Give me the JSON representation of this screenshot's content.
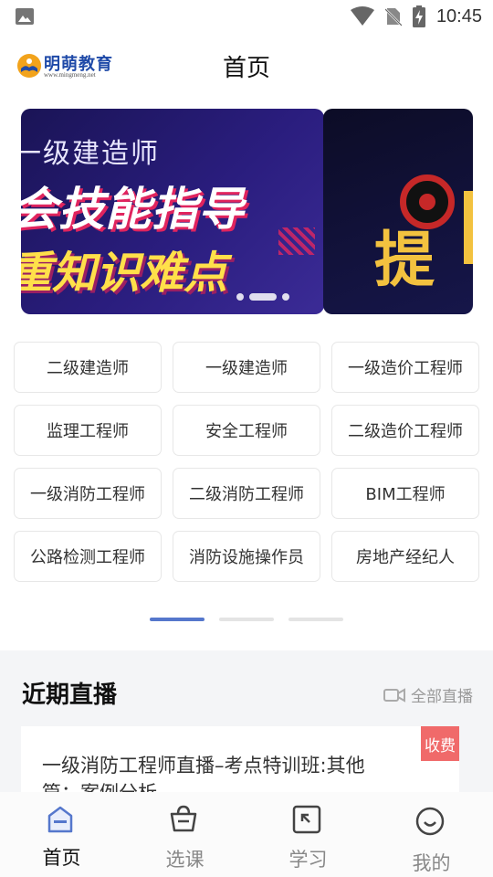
{
  "status_bar": {
    "time": "10:45"
  },
  "header": {
    "logo_text": "明萌教育",
    "logo_url": "www.mingmeng.net",
    "title": "首页"
  },
  "banner": {
    "line1": "一级建造师",
    "line2": "会技能指导",
    "line3": "重知识难点",
    "next_char": "提",
    "next_edge_char": "?",
    "dot_count": 3,
    "active_dot": 1
  },
  "categories": [
    "二级建造师",
    "一级建造师",
    "一级造价工程师",
    "监理工程师",
    "安全工程师",
    "二级造价工程师",
    "一级消防工程师",
    "二级消防工程师",
    "BIM工程师",
    "公路检测工程师",
    "消防设施操作员",
    "房地产经纪人"
  ],
  "category_pager": {
    "pages": 3,
    "active": 0
  },
  "live": {
    "section_title": "近期直播",
    "all_label": "全部直播",
    "card": {
      "title": "一级消防工程师直播–考点特训班:其他篇：案例分析",
      "tag": "收费"
    }
  },
  "tabs": [
    {
      "label": "首页",
      "icon": "home-icon",
      "active": true
    },
    {
      "label": "选课",
      "icon": "basket-icon",
      "active": false
    },
    {
      "label": "学习",
      "icon": "study-icon",
      "active": false
    },
    {
      "label": "我的",
      "icon": "smile-icon",
      "active": false
    }
  ],
  "colors": {
    "accent": "#5577cc",
    "fee_tag": "#f06a6a",
    "logo_blue": "#1f4aa8"
  }
}
